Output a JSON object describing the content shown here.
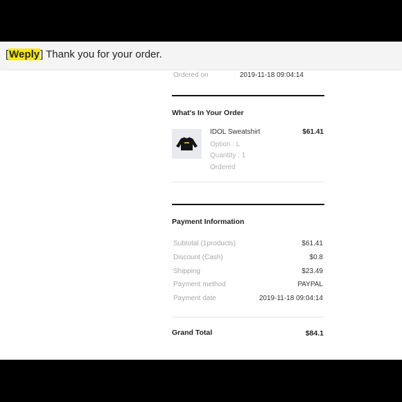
{
  "email": {
    "brand": "Weply",
    "subject_rest": " Thank you for your order."
  },
  "order": {
    "ordered_on_label": "Ordered on",
    "ordered_on_value": "2019-11-18 09:04:14"
  },
  "items_section": {
    "title": "What's In Your Order",
    "items": [
      {
        "name": "IDOL Sweatshirt",
        "price": "$61.41",
        "option": "Option : L",
        "quantity": "Quantity : 1",
        "status": "Ordered",
        "thumbnail_icon": "black-sweatshirt-thumbnail"
      }
    ]
  },
  "payment": {
    "title": "Payment Information",
    "rows": [
      {
        "label": "Subtotal (1products)",
        "value": "$61.41"
      },
      {
        "label": "Discount (Cash)",
        "value": "$0.8"
      },
      {
        "label": "Shipping",
        "value": "$23.49"
      },
      {
        "label": "Payment method",
        "value": "PAYPAL"
      },
      {
        "label": "Payment date",
        "value": "2019-11-18 09:04:14"
      }
    ]
  },
  "grand_total": {
    "label": "Grand Total",
    "value": "$84.1"
  },
  "colors": {
    "highlight": "#f7ea00",
    "muted_text": "#a8a8a8",
    "divider": "#111111"
  }
}
